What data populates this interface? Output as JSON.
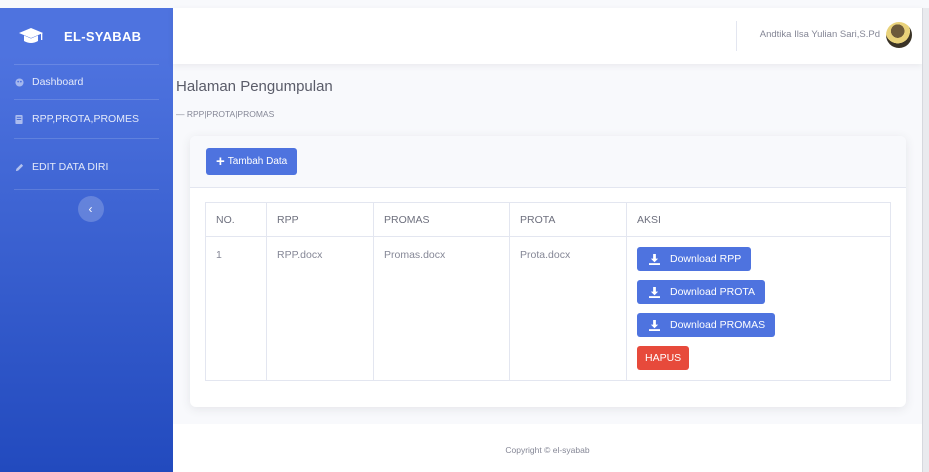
{
  "brand": {
    "name": "EL-SYABAB",
    "icon": "graduation-cap-icon"
  },
  "sidebar": {
    "items": [
      {
        "label": "Dashboard",
        "icon": "palette-icon"
      },
      {
        "label": "RPP,PROTA,PROMES",
        "icon": "book-icon"
      },
      {
        "label": "EDIT DATA DIRI",
        "icon": "pencil-icon"
      }
    ],
    "toggle_icon": "chevron-left-icon"
  },
  "topbar": {
    "user_name": "Andtika Ilsa Yulian Sari,S.Pd"
  },
  "main": {
    "title": "Halaman Pengumpulan",
    "breadcrumb": "— RPP|PROTA|PROMAS",
    "add_button": "Tambah Data",
    "table": {
      "headers": [
        "NO.",
        "RPP",
        "PROMAS",
        "PROTA",
        "AKSI"
      ],
      "rows": [
        {
          "no": "1",
          "rpp": "RPP.docx",
          "promas": "Promas.docx",
          "prota": "Prota.docx"
        }
      ],
      "actions": {
        "download_rpp": "Download RPP",
        "download_prota": "Download PROTA",
        "download_promas": "Download PROMAS",
        "delete": "HAPUS"
      }
    }
  },
  "footer": {
    "copyright": "Copyright © el-syabab"
  },
  "colors": {
    "primary": "#4e73df",
    "danger": "#e74a3b",
    "sidebar_end": "#224abe",
    "background": "#f8f9fc"
  }
}
